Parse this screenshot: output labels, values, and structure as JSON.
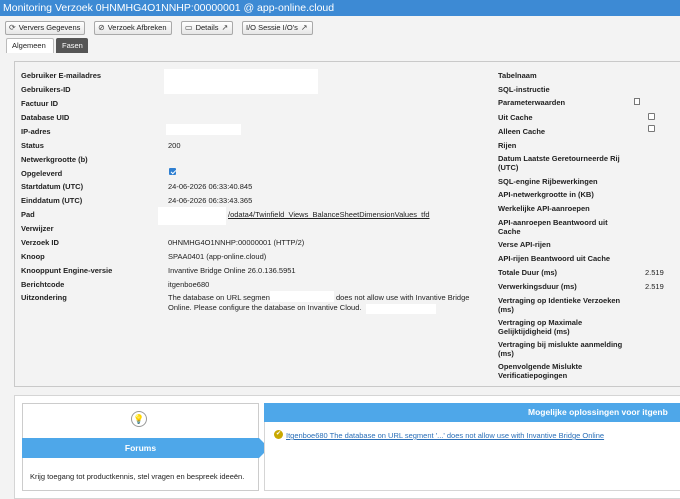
{
  "window": {
    "title": "Monitoring Verzoek 0HNMHG4O1NNHP:00000001 @ app-online.cloud"
  },
  "toolbar": {
    "refresh_label": "Ververs Gegevens",
    "abort_label": "Verzoek Afbreken",
    "details_label": "Details",
    "session_io_label": "I/O Sessie I/O's"
  },
  "tabs": {
    "general": "Algemeen",
    "phases": "Fasen"
  },
  "left_fields": {
    "email": {
      "label": "Gebruiker E-mailadres",
      "value": ""
    },
    "user_id": {
      "label": "Gebruikers-ID",
      "value": ""
    },
    "invoice_id": {
      "label": "Factuur ID",
      "value": ""
    },
    "database_uid": {
      "label": "Database UID",
      "value": ""
    },
    "ip": {
      "label": "IP-adres",
      "value": ""
    },
    "status": {
      "label": "Status",
      "value": "200"
    },
    "network_size": {
      "label": "Netwerkgrootte (b)",
      "value": ""
    },
    "delivered": {
      "label": "Opgeleverd",
      "checked": true
    },
    "start_date": {
      "label": "Startdatum (UTC)",
      "value": "24-06-2026 06:33:40.845"
    },
    "end_date": {
      "label": "Einddatum (UTC)",
      "value": "24-06-2026 06:33:43.365"
    },
    "path": {
      "label": "Pad",
      "value": "/odata4/Twinfield_Views_BalanceSheetDimensionValues_tfd"
    },
    "referrer": {
      "label": "Verwijzer",
      "value": ""
    },
    "request_id": {
      "label": "Verzoek ID",
      "value": "0HNMHG4O1NNHP:00000001 (HTTP/2)"
    },
    "node": {
      "label": "Knoop",
      "value": "SPAA0401 (app-online.cloud)"
    },
    "engine_version": {
      "label": "Knooppunt Engine-versie",
      "value": "Invantive Bridge Online 26.0.136.5951"
    },
    "message_code": {
      "label": "Berichtcode",
      "value": "itgenboe680"
    },
    "exception": {
      "label": "Uitzondering",
      "line1_pre": "The database on URL segment",
      "line1_post": "does not allow use with Invantive Bridge",
      "line2": "Online. Please configure the database on Invantive Cloud."
    }
  },
  "right_fields": {
    "table_name": {
      "label": "Tabelnaam",
      "value": ""
    },
    "sql": {
      "label": "SQL-instructie",
      "value": ""
    },
    "params": {
      "label": "Parameterwaarden",
      "icon": "document-icon"
    },
    "from_cache": {
      "label": "Uit Cache",
      "checked": false
    },
    "cache_only": {
      "label": "Alleen Cache",
      "checked": false
    },
    "rows": {
      "label": "Rijen",
      "value": ""
    },
    "last_row_date": {
      "label": "Datum Laatste Geretourneerde Rij (UTC)",
      "value": ""
    },
    "sql_ops": {
      "label": "SQL-engine Rijbewerkingen",
      "value": ""
    },
    "api_size": {
      "label": "API-netwerkgrootte in (KB)",
      "value": ""
    },
    "api_calls": {
      "label": "Werkelijke API-aanroepen",
      "value": ""
    },
    "api_cache": {
      "label": "API-aanroepen Beantwoord uit Cache",
      "value": ""
    },
    "api_rows": {
      "label": "Verse API-rijen",
      "value": ""
    },
    "api_rows_cache": {
      "label": "API-rijen Beantwoord uit Cache",
      "value": ""
    },
    "total_duration": {
      "label": "Totale Duur (ms)",
      "value": "2.519"
    },
    "processing": {
      "label": "Verwerkingsduur (ms)",
      "value": "2.519"
    },
    "delay_identical": {
      "label": "Vertraging op Identieke Verzoeken (ms)",
      "value": ""
    },
    "delay_parallel": {
      "label": "Vertraging op Maximale Gelijktijdigheid (ms)",
      "value": ""
    },
    "delay_failed_login": {
      "label": "Vertraging bij mislukte aanmelding (ms)",
      "value": ""
    },
    "open_failed_verif": {
      "label": "Openvolgende Mislukte Verificatiepogingen",
      "value": ""
    }
  },
  "forums": {
    "title": "Forums",
    "description": "Krijg toegang tot productkennis, stel vragen en bespreek ideeën."
  },
  "solutions": {
    "title": "Mogelijke oplossingen voor itgenb",
    "link": "Itgenboe680 The database on URL segment '...' does not allow use with Invantive Bridge Online"
  }
}
